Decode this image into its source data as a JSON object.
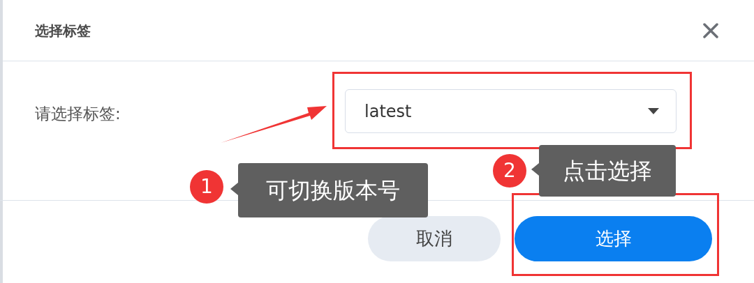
{
  "dialog": {
    "title": "选择标签",
    "field_label": "请选择标签:",
    "select_value": "latest",
    "buttons": [
      {
        "label": "取消",
        "kind": "secondary"
      },
      {
        "label": "选择",
        "kind": "primary"
      }
    ]
  },
  "annotations": [
    {
      "number": "1",
      "text": "可切换版本号"
    },
    {
      "number": "2",
      "text": "点击选择"
    }
  ]
}
